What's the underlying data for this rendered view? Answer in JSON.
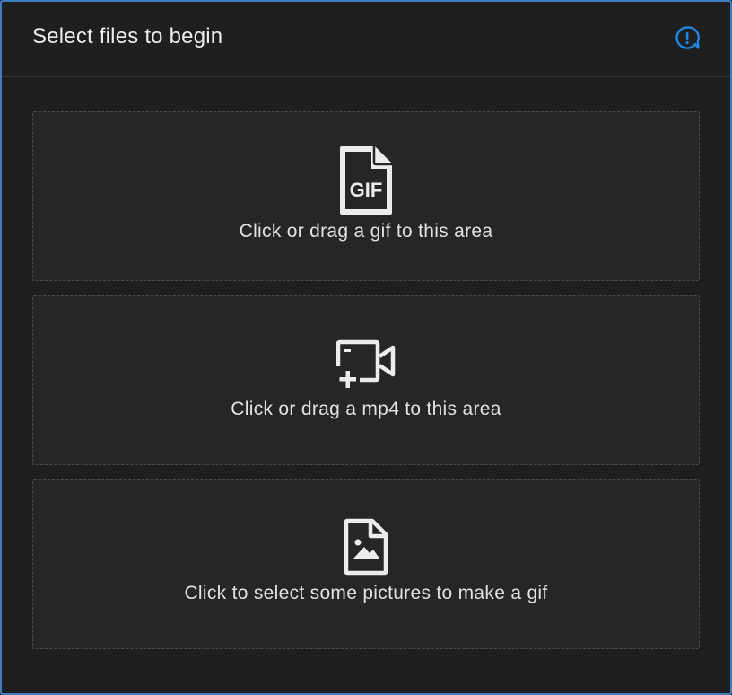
{
  "header": {
    "title": "Select files to begin",
    "info_icon": "feedback-info-icon",
    "accent_color": "#1e88e5"
  },
  "zones": [
    {
      "label": "Click or drag a gif to this area",
      "icon": "gif-file-icon",
      "icon_text": "GIF"
    },
    {
      "label": "Click or drag a mp4 to this area",
      "icon": "video-add-icon"
    },
    {
      "label": "Click to select some pictures to make a gif",
      "icon": "image-file-icon"
    }
  ]
}
